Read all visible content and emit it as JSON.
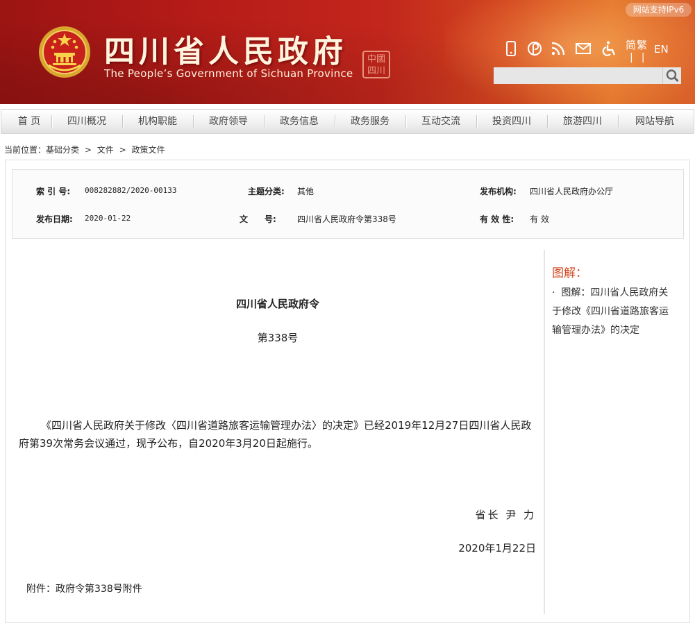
{
  "header": {
    "title": "四川省人民政府",
    "subtitle": "The People’s Government of Sichuan Province",
    "seal_text": "中国四川",
    "ipv6_badge": "网站支持IPv6",
    "lang_cn": "简繁",
    "lang_sep": "||",
    "lang_en": "EN",
    "icons": [
      "mobile-icon",
      "weibo-icon",
      "rss-icon",
      "mail-icon",
      "accessibility-icon"
    ],
    "search_placeholder": ""
  },
  "nav": {
    "items": [
      "首 页",
      "四川概况",
      "机构职能",
      "政府领导",
      "政务信息",
      "政务服务",
      "互动交流",
      "投资四川",
      "旅游四川",
      "网站导航"
    ]
  },
  "breadcrumb": {
    "prefix": "当前位置：",
    "items": [
      "基础分类",
      "文件",
      "政策文件"
    ],
    "separator": ">"
  },
  "meta": {
    "index_label": "索 引 号:",
    "index_value": "008282882/2020-00133",
    "topic_label": "主题分类:",
    "topic_value": "其他",
    "publisher_label": "发布机构:",
    "publisher_value": "四川省人民政府办公厅",
    "date_label": "发布日期:",
    "date_value": "2020-01-22",
    "doc_label": "文　　号:",
    "doc_value": "四川省人民政府令第338号",
    "validity_label": "有 效 性:",
    "validity_value": "有 效"
  },
  "article": {
    "title": "四川省人民政府令",
    "number": "第338号",
    "body": "《四川省人民政府关于修改〈四川省道路旅客运输管理办法〉的决定》已经2019年12月27日四川省人民政府第39次常务会议通过，现予公布，自2020年3月20日起施行。",
    "signature": "省长 尹 力",
    "date": "2020年1月22日",
    "attachment_prefix": "附件：",
    "attachment_link": "政府令第338号附件"
  },
  "sidebar": {
    "title": "图解：",
    "bullet": "·",
    "link": "图解：四川省人民政府关于修改《四川省道路旅客运输管理办法》的决定"
  },
  "colors": {
    "header_red": "#b71c18",
    "header_orange": "#e0742a",
    "sidebar_title": "#d2451e"
  }
}
